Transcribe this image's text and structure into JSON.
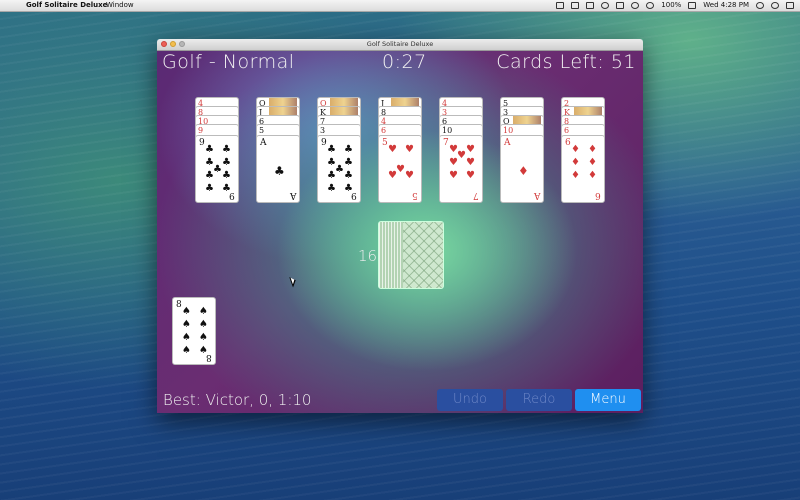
{
  "menubar": {
    "app_name": "Golf Solitaire Deluxe",
    "menu_window": "Window",
    "battery": "100%",
    "clock": "Wed 4:28 PM"
  },
  "window": {
    "title": "Golf Solitaire Deluxe"
  },
  "game": {
    "mode": "Golf - Normal",
    "timer": "0:27",
    "cards_left_label": "Cards Left:",
    "cards_left": "51",
    "stock_count": "16",
    "best_label": "Best:",
    "best_value": "Victor, 0, 1:10"
  },
  "columns": [
    {
      "cards": [
        {
          "r": "4",
          "s": "♦",
          "c": "red"
        },
        {
          "r": "8",
          "s": "♥",
          "c": "red"
        },
        {
          "r": "10",
          "s": "♦",
          "c": "red"
        },
        {
          "r": "9",
          "s": "♥",
          "c": "red"
        }
      ],
      "top": {
        "r": "9",
        "s": "♣",
        "c": "black"
      }
    },
    {
      "cards": [
        {
          "r": "Q",
          "s": "♣",
          "c": "black"
        },
        {
          "r": "J",
          "s": "♠",
          "c": "black"
        },
        {
          "r": "6",
          "s": "♠",
          "c": "black"
        },
        {
          "r": "5",
          "s": "♠",
          "c": "black"
        }
      ],
      "top": {
        "r": "A",
        "s": "♣",
        "c": "black"
      }
    },
    {
      "cards": [
        {
          "r": "Q",
          "s": "♦",
          "c": "red"
        },
        {
          "r": "K",
          "s": "♠",
          "c": "black"
        },
        {
          "r": "7",
          "s": "♣",
          "c": "black"
        },
        {
          "r": "3",
          "s": "♣",
          "c": "black"
        }
      ],
      "top": {
        "r": "9",
        "s": "♣",
        "c": "black"
      }
    },
    {
      "cards": [
        {
          "r": "J",
          "s": "♠",
          "c": "black"
        },
        {
          "r": "8",
          "s": "♠",
          "c": "black"
        },
        {
          "r": "4",
          "s": "♥",
          "c": "red"
        },
        {
          "r": "6",
          "s": "♥",
          "c": "red"
        }
      ],
      "top": {
        "r": "5",
        "s": "♥",
        "c": "red"
      }
    },
    {
      "cards": [
        {
          "r": "4",
          "s": "♥",
          "c": "red"
        },
        {
          "r": "3",
          "s": "♥",
          "c": "red"
        },
        {
          "r": "6",
          "s": "♣",
          "c": "black"
        },
        {
          "r": "10",
          "s": "♠",
          "c": "black"
        }
      ],
      "top": {
        "r": "7",
        "s": "♥",
        "c": "red"
      }
    },
    {
      "cards": [
        {
          "r": "5",
          "s": "♣",
          "c": "black"
        },
        {
          "r": "3",
          "s": "♠",
          "c": "black"
        },
        {
          "r": "Q",
          "s": "♣",
          "c": "black"
        },
        {
          "r": "10",
          "s": "♦",
          "c": "red"
        }
      ],
      "top": {
        "r": "A",
        "s": "♦",
        "c": "red"
      }
    },
    {
      "cards": [
        {
          "r": "2",
          "s": "♥",
          "c": "red"
        },
        {
          "r": "K",
          "s": "♥",
          "c": "red"
        },
        {
          "r": "8",
          "s": "♦",
          "c": "red"
        },
        {
          "r": "6",
          "s": "♦",
          "c": "red"
        }
      ],
      "top": {
        "r": "6",
        "s": "♦",
        "c": "red"
      }
    }
  ],
  "waste": {
    "r": "8",
    "s": "♠",
    "c": "black"
  },
  "buttons": {
    "undo": "Undo",
    "redo": "Redo",
    "menu": "Menu"
  },
  "colors": {
    "menu_button": "#1f8ff0",
    "disabled_button": "#2a4fa0"
  }
}
